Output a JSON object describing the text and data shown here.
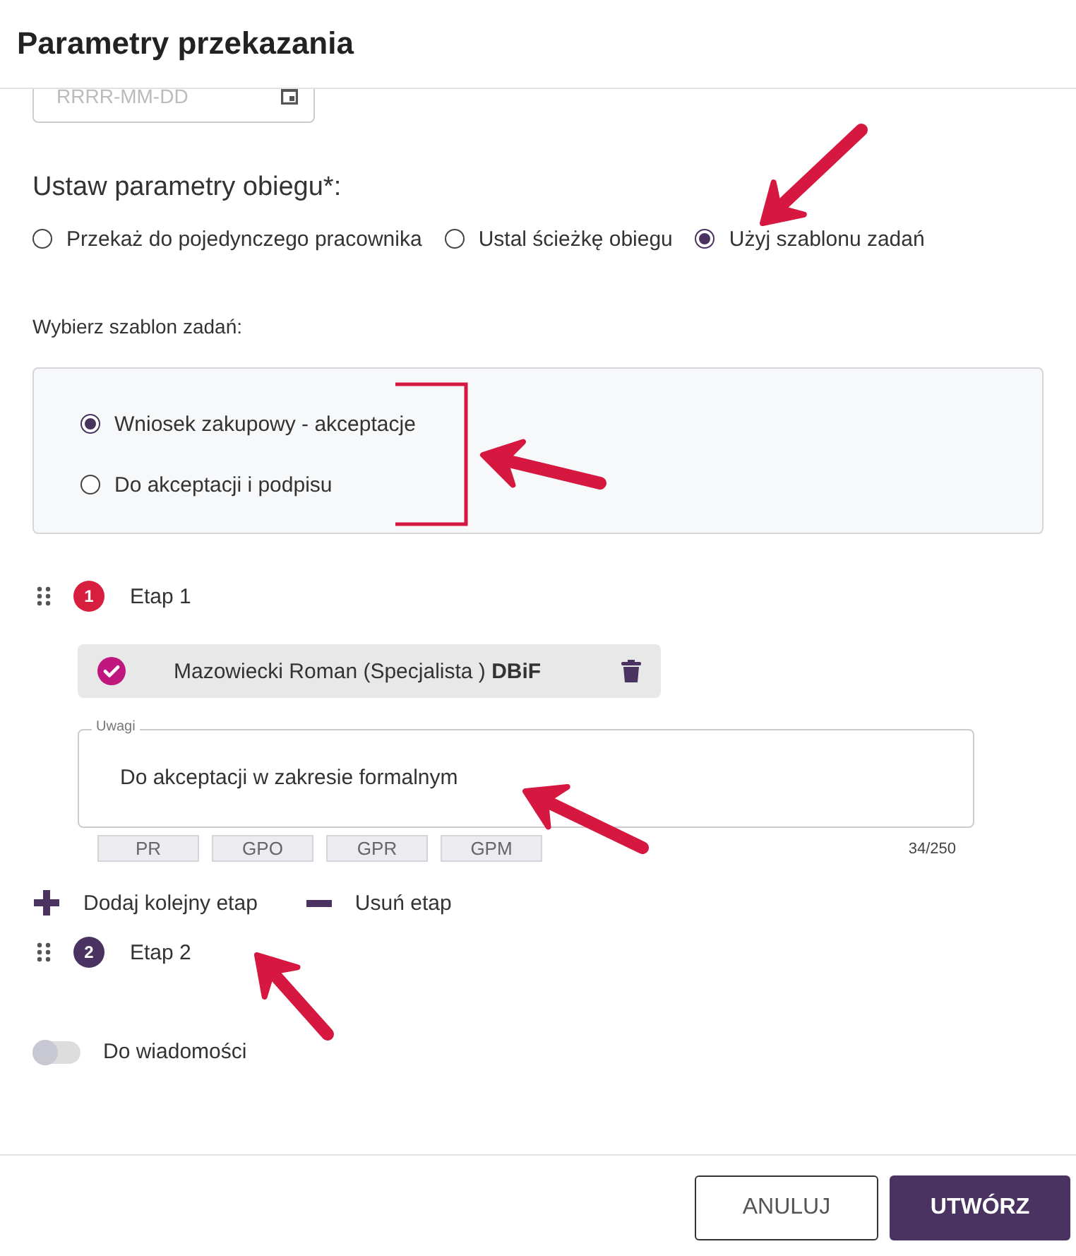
{
  "dialog": {
    "title": "Parametry przekazania"
  },
  "date_field": {
    "placeholder": "RRRR-MM-DD"
  },
  "circulation": {
    "heading": "Ustaw parametry obiegu*:",
    "options": [
      {
        "label": "Przekaż do pojedynczego pracownika",
        "selected": false
      },
      {
        "label": "Ustal ścieżkę obiegu",
        "selected": false
      },
      {
        "label": "Użyj szablonu zadań",
        "selected": true
      }
    ]
  },
  "template": {
    "heading": "Wybierz szablon zadań:",
    "options": [
      {
        "label": "Wniosek zakupowy - akceptacje",
        "selected": true
      },
      {
        "label": "Do akceptacji i podpisu",
        "selected": false
      }
    ]
  },
  "stages": [
    {
      "number": "1",
      "label": "Etap 1",
      "color": "#d81e3f",
      "assignees": [
        {
          "name": "Mazowiecki Roman (Specjalista ) **DBiF**",
          "checked": true
        }
      ],
      "notes": {
        "label": "Uwagi",
        "value": "Do akceptacji w zakresie formalnym",
        "counter": "34/250"
      },
      "tags": [
        "PR",
        "GPO",
        "GPR",
        "GPM"
      ]
    },
    {
      "number": "2",
      "label": "Etap 2",
      "color": "#4a3360"
    }
  ],
  "stage_actions": [
    {
      "kind": "add",
      "label": "Dodaj kolejny etap"
    },
    {
      "kind": "remove",
      "label": "Usuń etap"
    }
  ],
  "notify_toggle": {
    "label": "Do wiadomości",
    "on": false
  },
  "buttons": [
    {
      "kind": "secondary",
      "label": "ANULUJ"
    },
    {
      "kind": "primary",
      "label": "UTWÓRZ"
    }
  ]
}
